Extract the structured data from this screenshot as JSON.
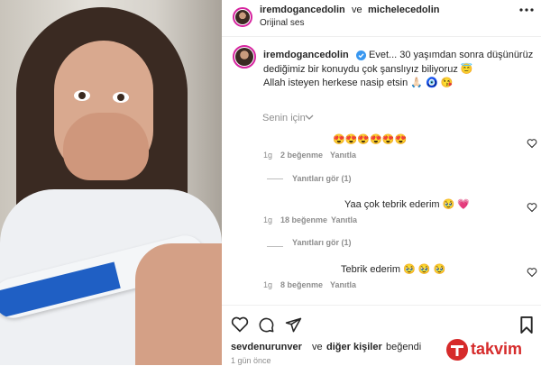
{
  "header": {
    "user1": "iremdogancedolin",
    "conj": "ve",
    "user2": "michelecedolin",
    "audio": "Orijinal ses",
    "more_icon": "ellipsis-icon"
  },
  "caption": {
    "username": "iremdogancedolin",
    "line1": "Evet... 30 yaşımdan sonra düşünürüz",
    "line2": "dediğimiz bir konuydu çok şanslıyız biliyoruz 😇",
    "line3": "Allah isteyen herkese nasip etsin 🙏🏻 🧿 😘"
  },
  "filter": {
    "label": "Senin için"
  },
  "comments": [
    {
      "text": "😍😍😍😍😍😍",
      "time": "1g",
      "likes": "2 beğenme",
      "reply": "Yanıtla",
      "replies": "Yanıtları gör (1)"
    },
    {
      "text": "Yaa çok tebrik ederim 🥹 💗",
      "time": "1g",
      "likes": "18 beğenme",
      "reply": "Yanıtla",
      "replies": "Yanıtları gör (1)"
    },
    {
      "text": "Tebrik ederim 🥹 🥹 🥹",
      "time": "1g",
      "likes": "8 beğenme",
      "reply": "Yanıtla",
      "replies": ""
    }
  ],
  "footer": {
    "likers_user": "sevdenurunver",
    "likers_conj": "ve",
    "likers_others": "diğer kişiler",
    "likers_verb": "beğendi",
    "date": "1 gün önce",
    "watermark": "takvim"
  }
}
